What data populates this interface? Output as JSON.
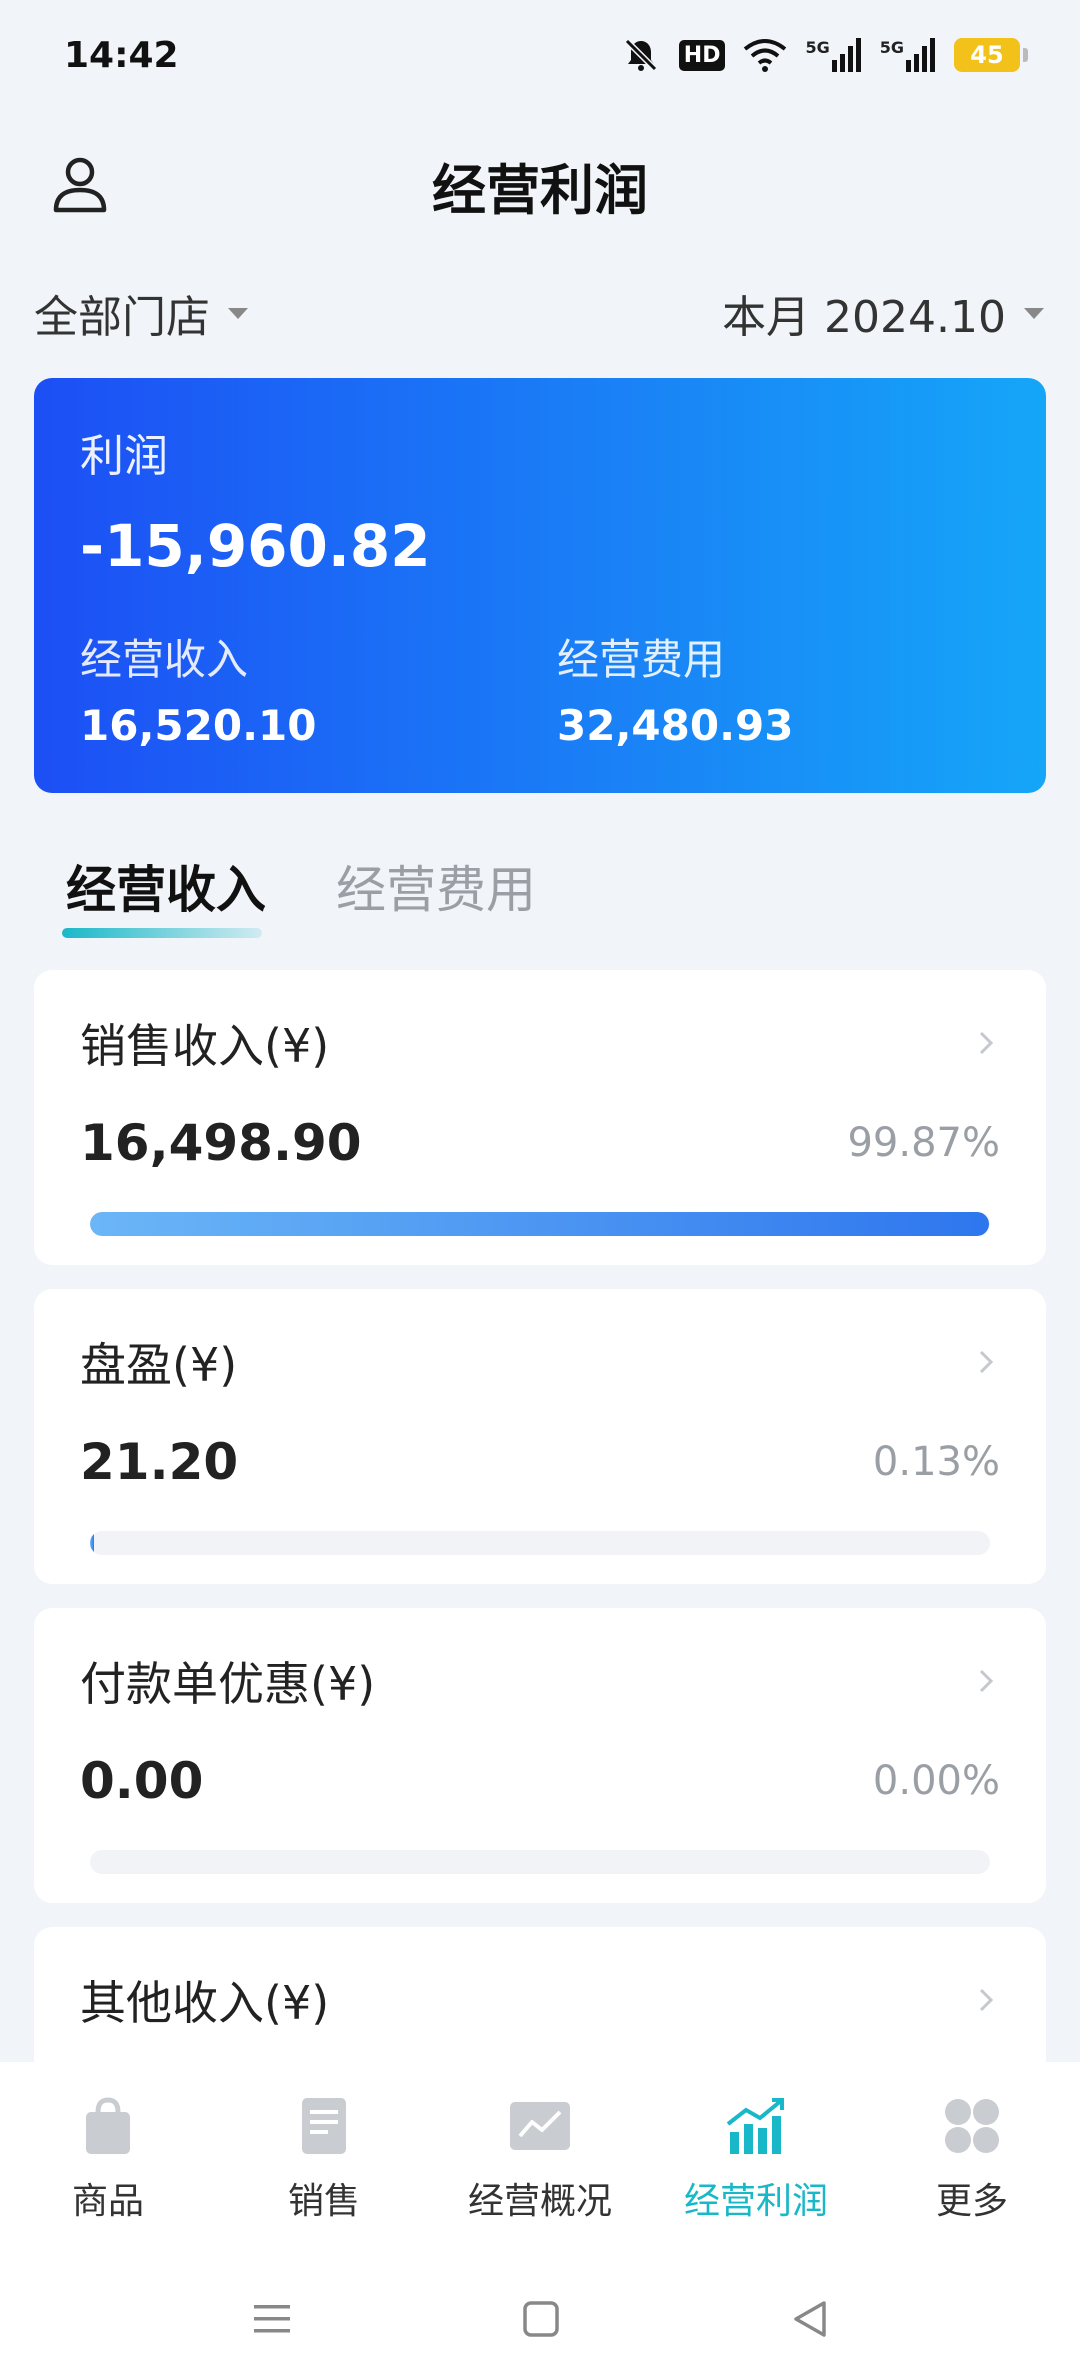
{
  "status_bar": {
    "time": "14:42",
    "hd_label": "HD",
    "net_5g_1": "5G",
    "net_5g_2": "5G",
    "battery": "45"
  },
  "header": {
    "title": "经营利润"
  },
  "filters": {
    "store": "全部门店",
    "period": "本月 2024.10"
  },
  "profit_card": {
    "label": "利润",
    "value": "-15,960.82",
    "income_label": "经营收入",
    "income_value": "16,520.10",
    "expense_label": "经营费用",
    "expense_value": "32,480.93"
  },
  "tabs": [
    {
      "label": "经营收入",
      "active": true
    },
    {
      "label": "经营费用",
      "active": false
    }
  ],
  "items": [
    {
      "title": "销售收入(¥)",
      "value": "16,498.90",
      "percent_text": "99.87%",
      "fraction": 0.9987
    },
    {
      "title": "盘盈(¥)",
      "value": "21.20",
      "percent_text": "0.13%",
      "fraction": 0.0013
    },
    {
      "title": "付款单优惠(¥)",
      "value": "0.00",
      "percent_text": "0.00%",
      "fraction": 0.0
    },
    {
      "title": "其他收入(¥)"
    }
  ],
  "bottom_nav": [
    {
      "label": "商品",
      "icon": "shopping-bag-icon"
    },
    {
      "label": "销售",
      "icon": "document-icon"
    },
    {
      "label": "经营概况",
      "icon": "line-chart-icon"
    },
    {
      "label": "经营利润",
      "icon": "bar-chart-icon",
      "active": true
    },
    {
      "label": "更多",
      "icon": "grid-icon"
    }
  ],
  "colors": {
    "accent": "#19b8c8",
    "card_blue_start": "#1c4ff5",
    "card_blue_end": "#15a6f8",
    "bar_start": "#6bb6f7",
    "bar_end": "#2e76ee"
  }
}
